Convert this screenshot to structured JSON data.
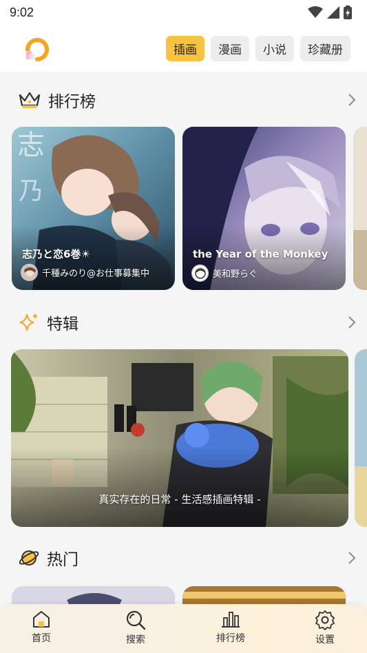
{
  "status_bar": {
    "time": "9:02"
  },
  "header": {
    "tabs": [
      {
        "label": "插画",
        "active": true
      },
      {
        "label": "漫画",
        "active": false
      },
      {
        "label": "小说",
        "active": false
      },
      {
        "label": "珍藏册",
        "active": false
      }
    ],
    "accent_color": "#f6c343"
  },
  "sections": {
    "ranking": {
      "title": "排行榜",
      "icon": "crown-icon",
      "cards": [
        {
          "title": "志乃と恋6巻☀",
          "author": "千種みのり@お仕事募集中"
        },
        {
          "title": "the Year of the Monkey",
          "author": "美和野らぐ"
        }
      ]
    },
    "special": {
      "title": "特辑",
      "icon": "sparkle-icon",
      "feature": {
        "title": "真实存在的日常 - 生活感插画特辑 -"
      }
    },
    "hot": {
      "title": "热门",
      "icon": "planet-icon"
    }
  },
  "bottom_nav": [
    {
      "label": "首页",
      "icon": "home-icon"
    },
    {
      "label": "搜索",
      "icon": "search-icon"
    },
    {
      "label": "排行榜",
      "icon": "bar-chart-icon"
    },
    {
      "label": "设置",
      "icon": "settings-icon"
    }
  ]
}
